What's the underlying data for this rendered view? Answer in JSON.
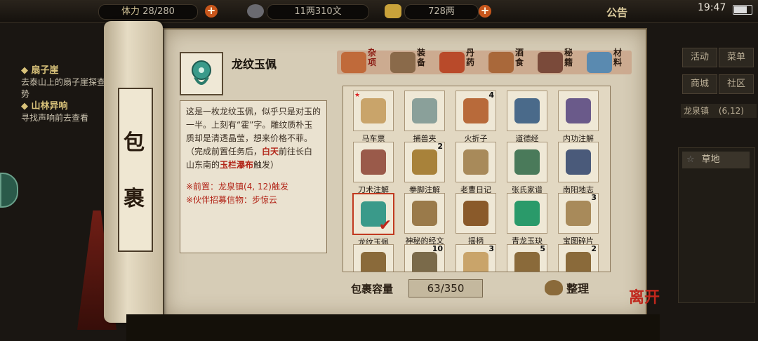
{
  "topbar": {
    "stat1": "28/280",
    "stat1_prefix": "体力",
    "money": "11两310文",
    "silver": "728两",
    "notice": "公告",
    "clock": "19:47"
  },
  "quests": [
    {
      "title": "扇子崖",
      "text": "去泰山上的扇子崖探查地势"
    },
    {
      "title": "山林异响",
      "text": "寻找声响前去查看"
    }
  ],
  "right_panel": {
    "buttons": [
      "活动",
      "菜单",
      "商城",
      "社区"
    ],
    "location": "龙泉镇",
    "coords": "(6,12)",
    "terrain": "草地"
  },
  "scroll_label": [
    "包",
    "裹"
  ],
  "item": {
    "name": "龙纹玉佩",
    "icon": "jade-pendant-icon",
    "desc_part1": "这是一枚龙纹玉佩，似乎只是对玉的一半。上刻有“霍”字。雕纹质朴玉质却是清透晶莹，想来价格不菲。（完成前置任务后，",
    "desc_hl1": "白天",
    "desc_part2": "前往长白山东南的",
    "desc_hl2": "玉栏瀑布",
    "desc_part3": "触发）",
    "req1": "※前置：龙泉镇(4, 12)触发",
    "req2": "※伙伴招募信物：步惊云"
  },
  "tabs": [
    {
      "label": "杂项",
      "icon": "jar-icon",
      "color": "#c06a3a"
    },
    {
      "label": "装备",
      "icon": "weapon-icon",
      "color": "#8a6a4a"
    },
    {
      "label": "丹药",
      "icon": "pill-icon",
      "color": "#b94a2a"
    },
    {
      "label": "酒食",
      "icon": "food-icon",
      "color": "#a9683a"
    },
    {
      "label": "秘籍",
      "icon": "book-icon",
      "color": "#7a4a3a"
    },
    {
      "label": "材料",
      "icon": "crystal-icon",
      "color": "#5a8ab0"
    }
  ],
  "items": [
    {
      "name": "马车票",
      "count": "",
      "icon": "ticket-icon",
      "color": "#c9a46a",
      "flag": true
    },
    {
      "name": "捕兽夹",
      "count": "",
      "icon": "trap-icon",
      "color": "#8aa09a"
    },
    {
      "name": "火折子",
      "count": "4",
      "icon": "fire-icon",
      "color": "#b86a3a"
    },
    {
      "name": "道德经",
      "count": "",
      "icon": "book-icon",
      "color": "#4a6a8a"
    },
    {
      "name": "内功注解",
      "count": "",
      "icon": "scroll-icon",
      "color": "#6a5a8a"
    },
    {
      "name": "刀术注解",
      "count": "",
      "icon": "scroll-icon",
      "color": "#9a5a4a"
    },
    {
      "name": "拳脚注解",
      "count": "2",
      "icon": "scroll-icon",
      "color": "#a8823a"
    },
    {
      "name": "老曹日记",
      "count": "",
      "icon": "page-icon",
      "color": "#a88a5a"
    },
    {
      "name": "张氏家谱",
      "count": "",
      "icon": "book-icon",
      "color": "#4a7a5a"
    },
    {
      "name": "南阳地志",
      "count": "",
      "icon": "book-icon",
      "color": "#4a5a7a"
    },
    {
      "name": "龙纹玉佩",
      "count": "",
      "icon": "jade-pendant-icon",
      "color": "#3a9a8a",
      "selected": true
    },
    {
      "name": "神秘的经文",
      "count": "",
      "icon": "page-icon",
      "color": "#9a7a4a"
    },
    {
      "name": "摇柄",
      "count": "",
      "icon": "crank-icon",
      "color": "#8a5a2a"
    },
    {
      "name": "青龙玉玦",
      "count": "",
      "icon": "jade-icon",
      "color": "#2a9a6a"
    },
    {
      "name": "宝图碎片",
      "count": "3",
      "icon": "map-icon",
      "color": "#a88a5a"
    },
    {
      "name": "",
      "count": "",
      "icon": "bamboo-icon",
      "color": "#8a6a3a"
    },
    {
      "name": "",
      "count": "10",
      "icon": "bamboo-icon",
      "color": "#7a6a4a"
    },
    {
      "name": "",
      "count": "3",
      "icon": "scroll-icon",
      "color": "#c9a46a"
    },
    {
      "name": "",
      "count": "5",
      "icon": "herb-icon",
      "color": "#8a6a3a"
    },
    {
      "name": "",
      "count": "2",
      "icon": "bamboo-icon",
      "color": "#8a6a3a"
    }
  ],
  "capacity": {
    "label": "包裹容量",
    "value": "63/350"
  },
  "sort_label": "整理",
  "leave_label": "离开"
}
